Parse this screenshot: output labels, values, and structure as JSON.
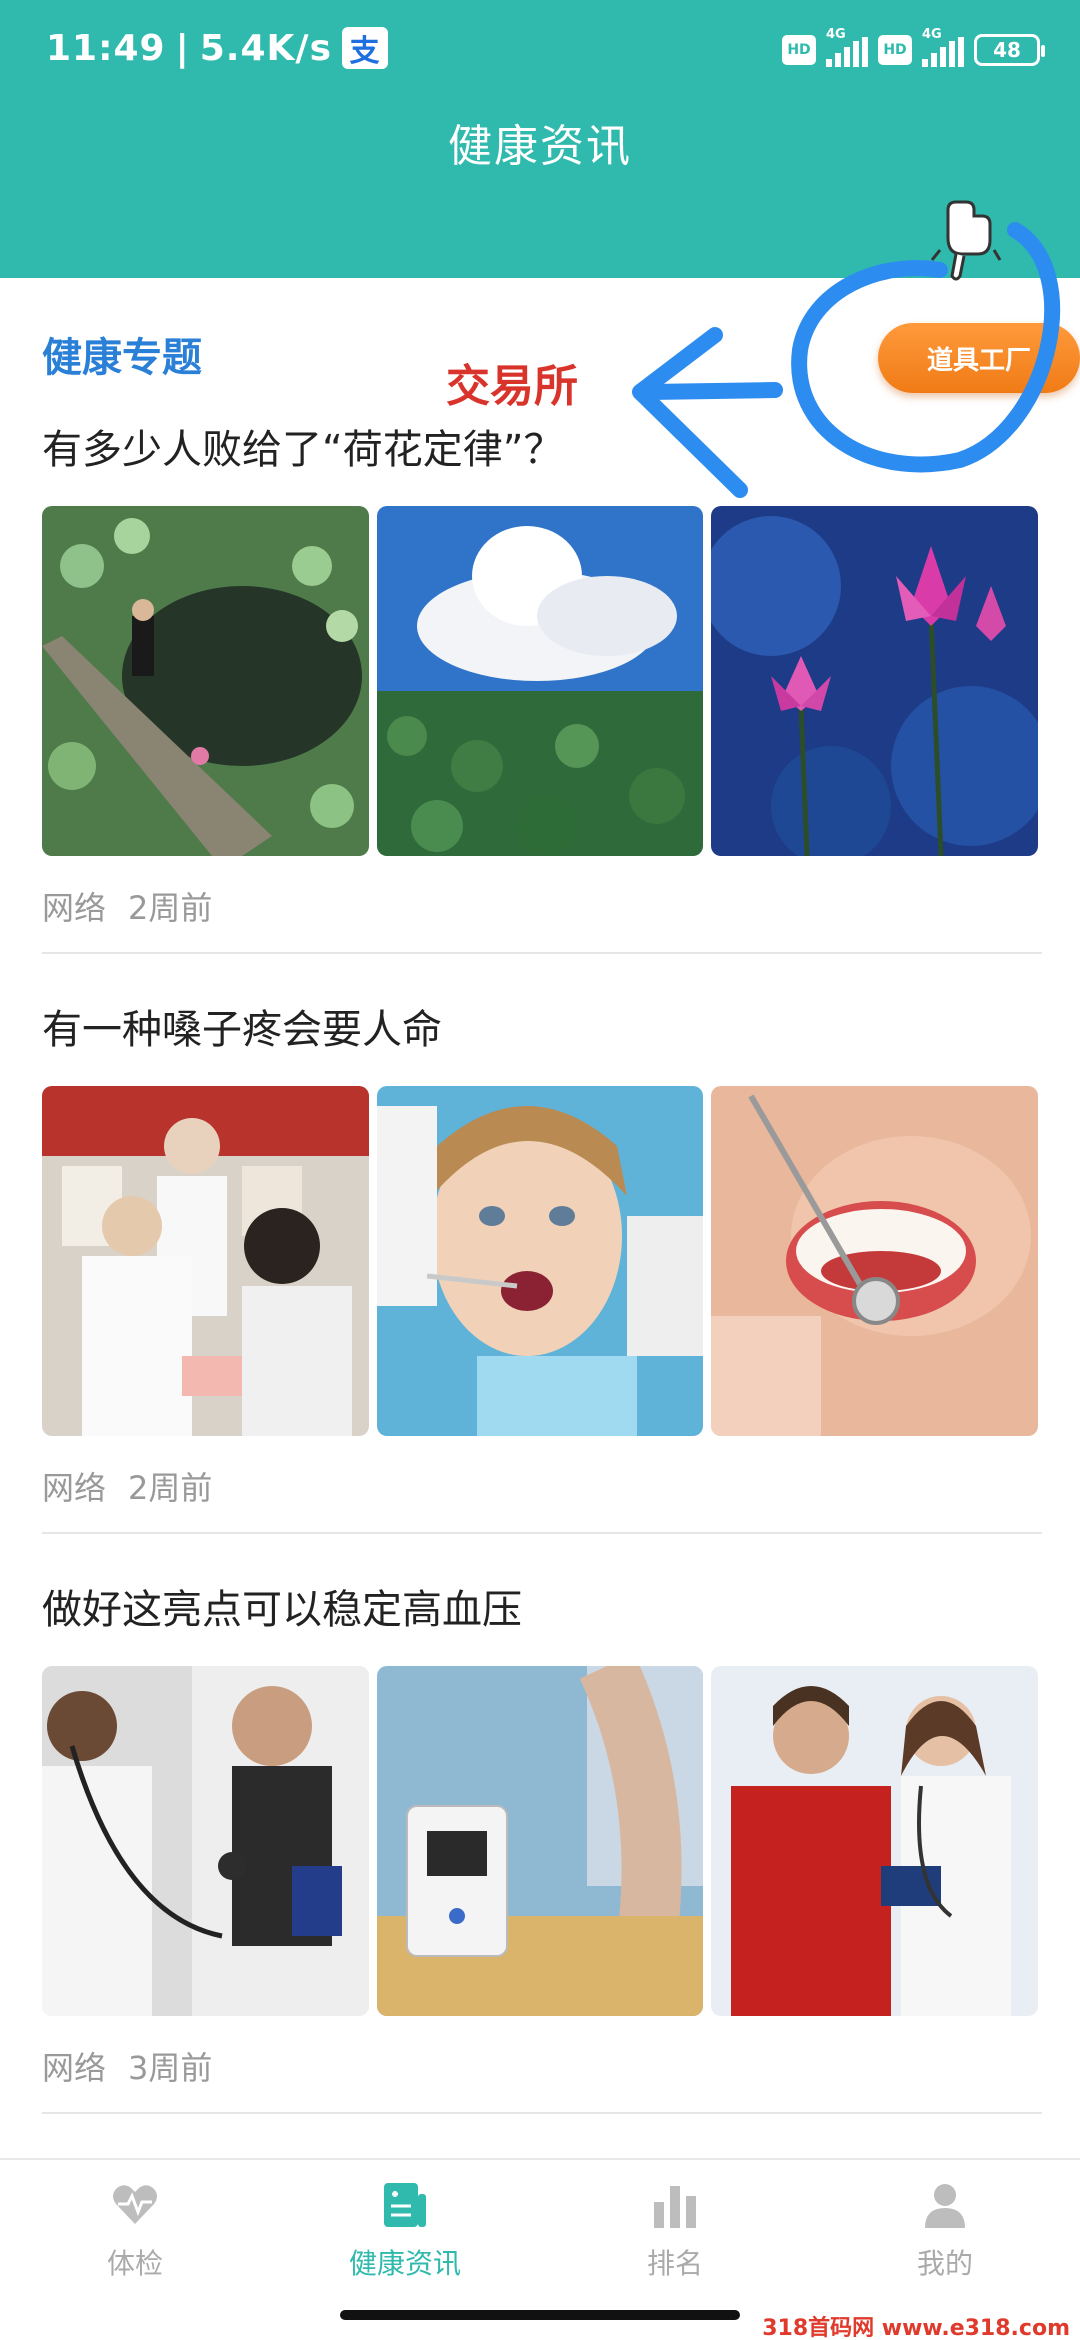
{
  "status_bar": {
    "time": "11:49",
    "speed": "5.4K/s",
    "notif_glyph": "支",
    "hd1": "HD",
    "net1": "4G",
    "hd2": "HD",
    "net2": "4G",
    "battery": "48"
  },
  "header": {
    "title": "健康资讯"
  },
  "section": {
    "title": "健康专题",
    "tool_button": "道具工厂"
  },
  "annotation": {
    "text": "交易所"
  },
  "articles": [
    {
      "title": "有多少人败给了“荷花定律”？",
      "source": "网络",
      "time": "2周前"
    },
    {
      "title": "有一种嗓子疼会要人命",
      "source": "网络",
      "time": "2周前"
    },
    {
      "title": "做好这亮点可以稳定高血压",
      "source": "网络",
      "time": "3周前"
    }
  ],
  "tabs": [
    {
      "label": "体检",
      "icon": "heartbeat-icon",
      "active": false
    },
    {
      "label": "健康资讯",
      "icon": "news-icon",
      "active": true
    },
    {
      "label": "排名",
      "icon": "bar-chart-icon",
      "active": false
    },
    {
      "label": "我的",
      "icon": "user-icon",
      "active": false
    }
  ],
  "watermark": "318首码网 www.e318.com",
  "colors": {
    "header": "#2fbaad",
    "section_title": "#2a7fd6",
    "tool_button": "#f5861f",
    "annotation_text": "#d9342b",
    "annotation_ink": "#2d8cf0",
    "active_tab": "#2fbaad",
    "inactive_tab": "#aaaaaa"
  }
}
